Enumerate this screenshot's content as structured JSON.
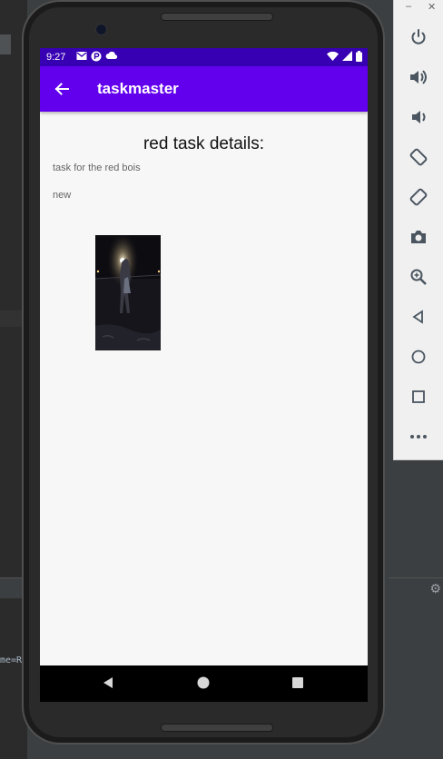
{
  "ide": {
    "code_fragment": "me=R"
  },
  "statusbar": {
    "time": "9:27"
  },
  "appbar": {
    "title": "taskmaster"
  },
  "detail": {
    "heading": "red task details:",
    "description": "task for the red bois",
    "state": "new"
  },
  "emulator_toolbar": {
    "items": [
      "power-icon",
      "volume-up-icon",
      "volume-down-icon",
      "rotate-left-icon",
      "rotate-right-icon",
      "camera-icon",
      "zoom-icon",
      "back-icon",
      "home-icon",
      "overview-icon",
      "more-icon"
    ]
  },
  "navbar": {
    "items": [
      "back-icon",
      "home-icon",
      "recents-icon"
    ]
  },
  "colors": {
    "statusbar": "#3700b3",
    "appbar": "#6200ee",
    "background": "#f7f7f7"
  }
}
